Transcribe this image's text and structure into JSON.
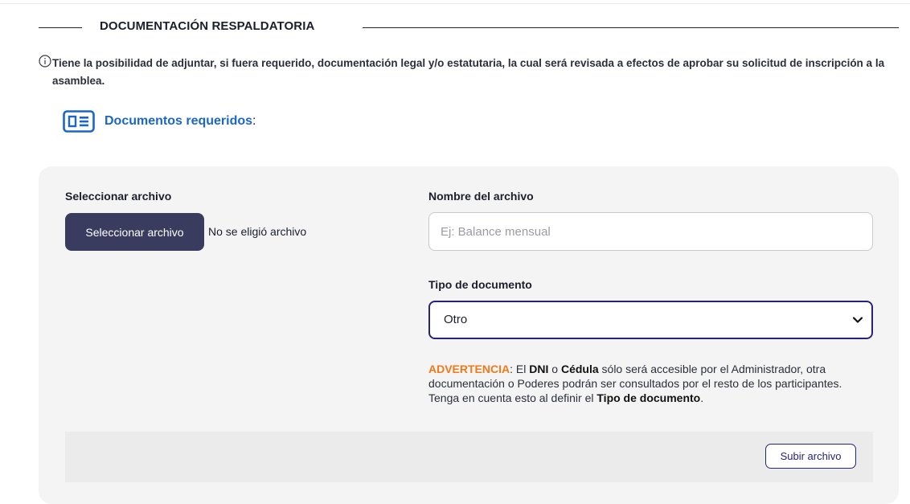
{
  "section": {
    "title": "DOCUMENTACIÓN RESPALDATORIA"
  },
  "info": {
    "text": "Tiene la posibilidad de adjuntar, si fuera requerido, documentación legal y/o estatutaria, la cual será revisada a efectos de aprobar su solicitud de inscripción a la asamblea."
  },
  "docs_required": {
    "label": "Documentos requeridos",
    "suffix": ":"
  },
  "file_picker": {
    "label": "Seleccionar archivo",
    "button": "Seleccionar archivo",
    "status": "No se eligió archivo"
  },
  "file_name": {
    "label": "Nombre del archivo",
    "value": "",
    "placeholder": "Ej: Balance mensual"
  },
  "doc_type": {
    "label": "Tipo de documento",
    "selected": "Otro"
  },
  "warning": {
    "prefix": "ADVERTENCIA",
    "t1": ": El ",
    "b1": "DNI",
    "t2": " o ",
    "b2": "Cédula",
    "t3": " sólo será accesible por el Administrador, otra documentación o Poderes podrán ser consultados por el resto de los participantes. Tenga en cuenta esto al definir el ",
    "b3": "Tipo de documento",
    "t4": "."
  },
  "upload": {
    "button": "Subir archivo"
  },
  "colors": {
    "accent_blue": "#1b66c9",
    "primary_dark": "#3a3c5f",
    "border_navy": "#26237a",
    "warning_orange": "#f07a1a",
    "card_bg": "#f4f4f5"
  },
  "icons": [
    "info-icon",
    "document-card-icon",
    "chevron-down-icon"
  ]
}
